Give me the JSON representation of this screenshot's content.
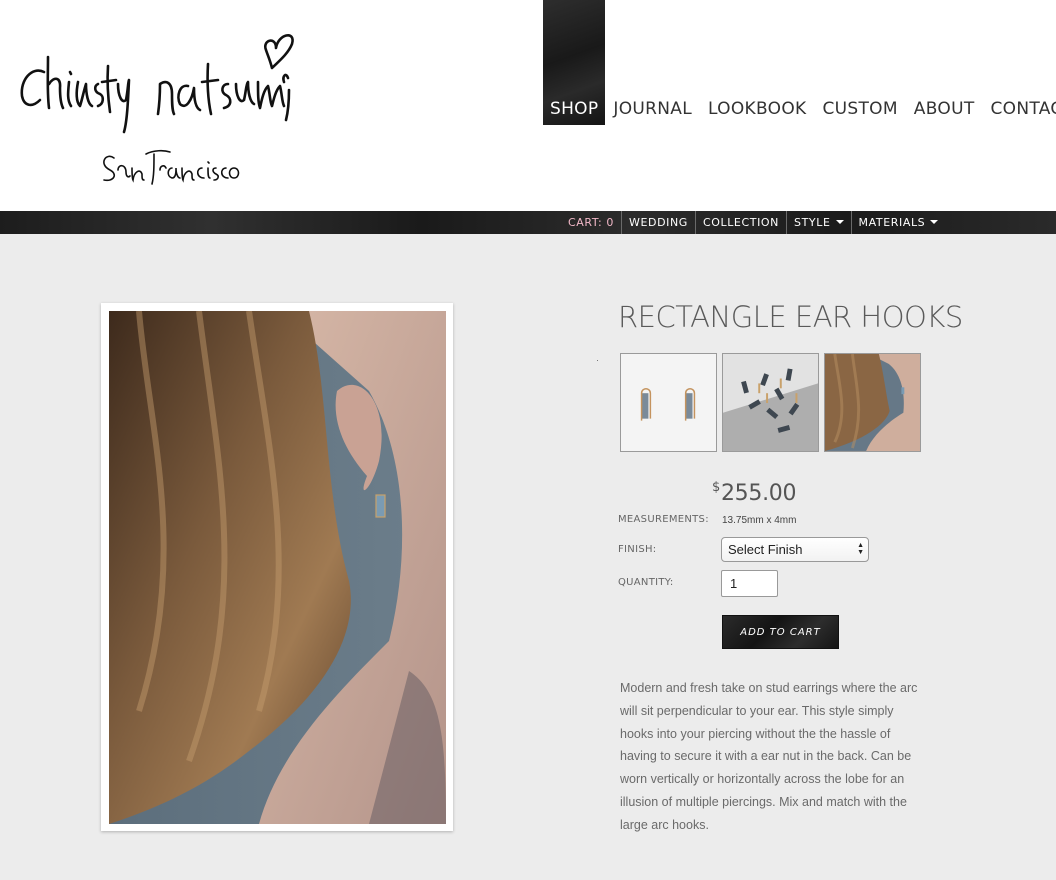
{
  "brand": {
    "name": "christy natsumi",
    "location": "San Francisco"
  },
  "main_nav": [
    {
      "label": "SHOP",
      "active": true
    },
    {
      "label": "JOURNAL"
    },
    {
      "label": "LOOKBOOK"
    },
    {
      "label": "CUSTOM"
    },
    {
      "label": "ABOUT"
    },
    {
      "label": "CONTACT"
    }
  ],
  "sub_nav": {
    "cart": "CART: 0",
    "wedding": "WEDDING",
    "collection": "COLLECTION",
    "style": "STYLE",
    "materials": "MATERIALS"
  },
  "product": {
    "title": "RECTANGLE EAR HOOKS",
    "currency": "$",
    "price": "255.00",
    "measurements_label": "MEASUREMENTS:",
    "measurements_value": "13.75mm x 4mm",
    "finish_label": "FINISH:",
    "finish_selected": "Select Finish",
    "quantity_label": "QUANTITY:",
    "quantity_value": "1",
    "add_to_cart": "ADD TO CART",
    "description": "Modern and fresh take on stud earrings where the arc will sit perpendicular to your ear.  This style simply hooks into your piercing without the the hassle of having to secure it with a ear nut in the back.  Can be worn vertically or horizontally across the lobe for an illusion of multiple piercings.  Mix and match with the large arc hooks."
  },
  "colors": {
    "page_bg": "#ececec",
    "dark_bar": "#1f1f1f",
    "cart_accent": "#f2b8c8"
  }
}
